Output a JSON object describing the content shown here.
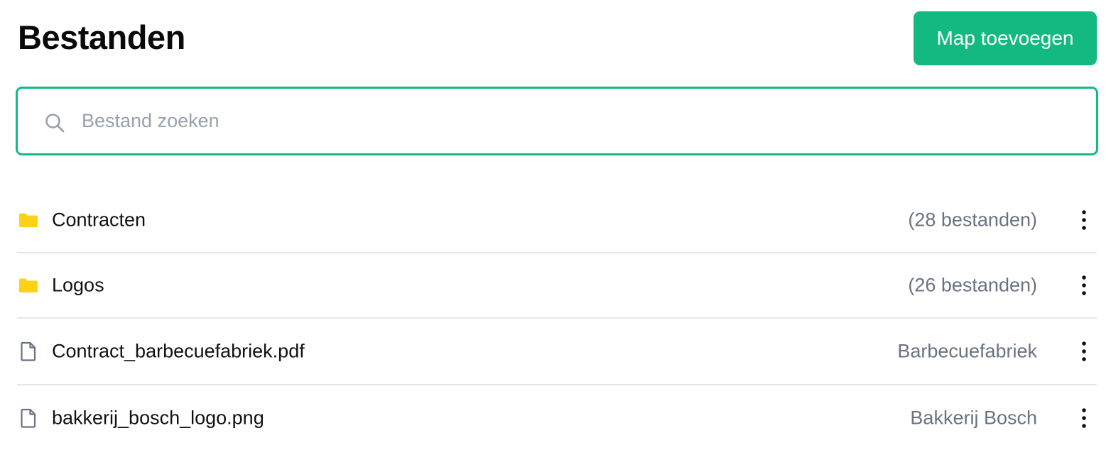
{
  "header": {
    "title": "Bestanden",
    "add_folder_label": "Map toevoegen"
  },
  "search": {
    "placeholder": "Bestand zoeken",
    "value": "",
    "icon": "search-icon"
  },
  "items": [
    {
      "type": "folder",
      "icon": "folder-icon",
      "name": "Contracten",
      "meta": "(28 bestanden)"
    },
    {
      "type": "folder",
      "icon": "folder-icon",
      "name": "Logos",
      "meta": "(26 bestanden)"
    },
    {
      "type": "file",
      "icon": "file-icon",
      "name": "Contract_barbecuefabriek.pdf",
      "meta": "Barbecuefabriek"
    },
    {
      "type": "file",
      "icon": "file-icon",
      "name": "bakkerij_bosch_logo.png",
      "meta": "Bakkerij Bosch"
    }
  ],
  "colors": {
    "accent": "#14b881",
    "folder": "#fcd116",
    "muted_text": "#6b7280",
    "divider": "#e5e7eb"
  }
}
